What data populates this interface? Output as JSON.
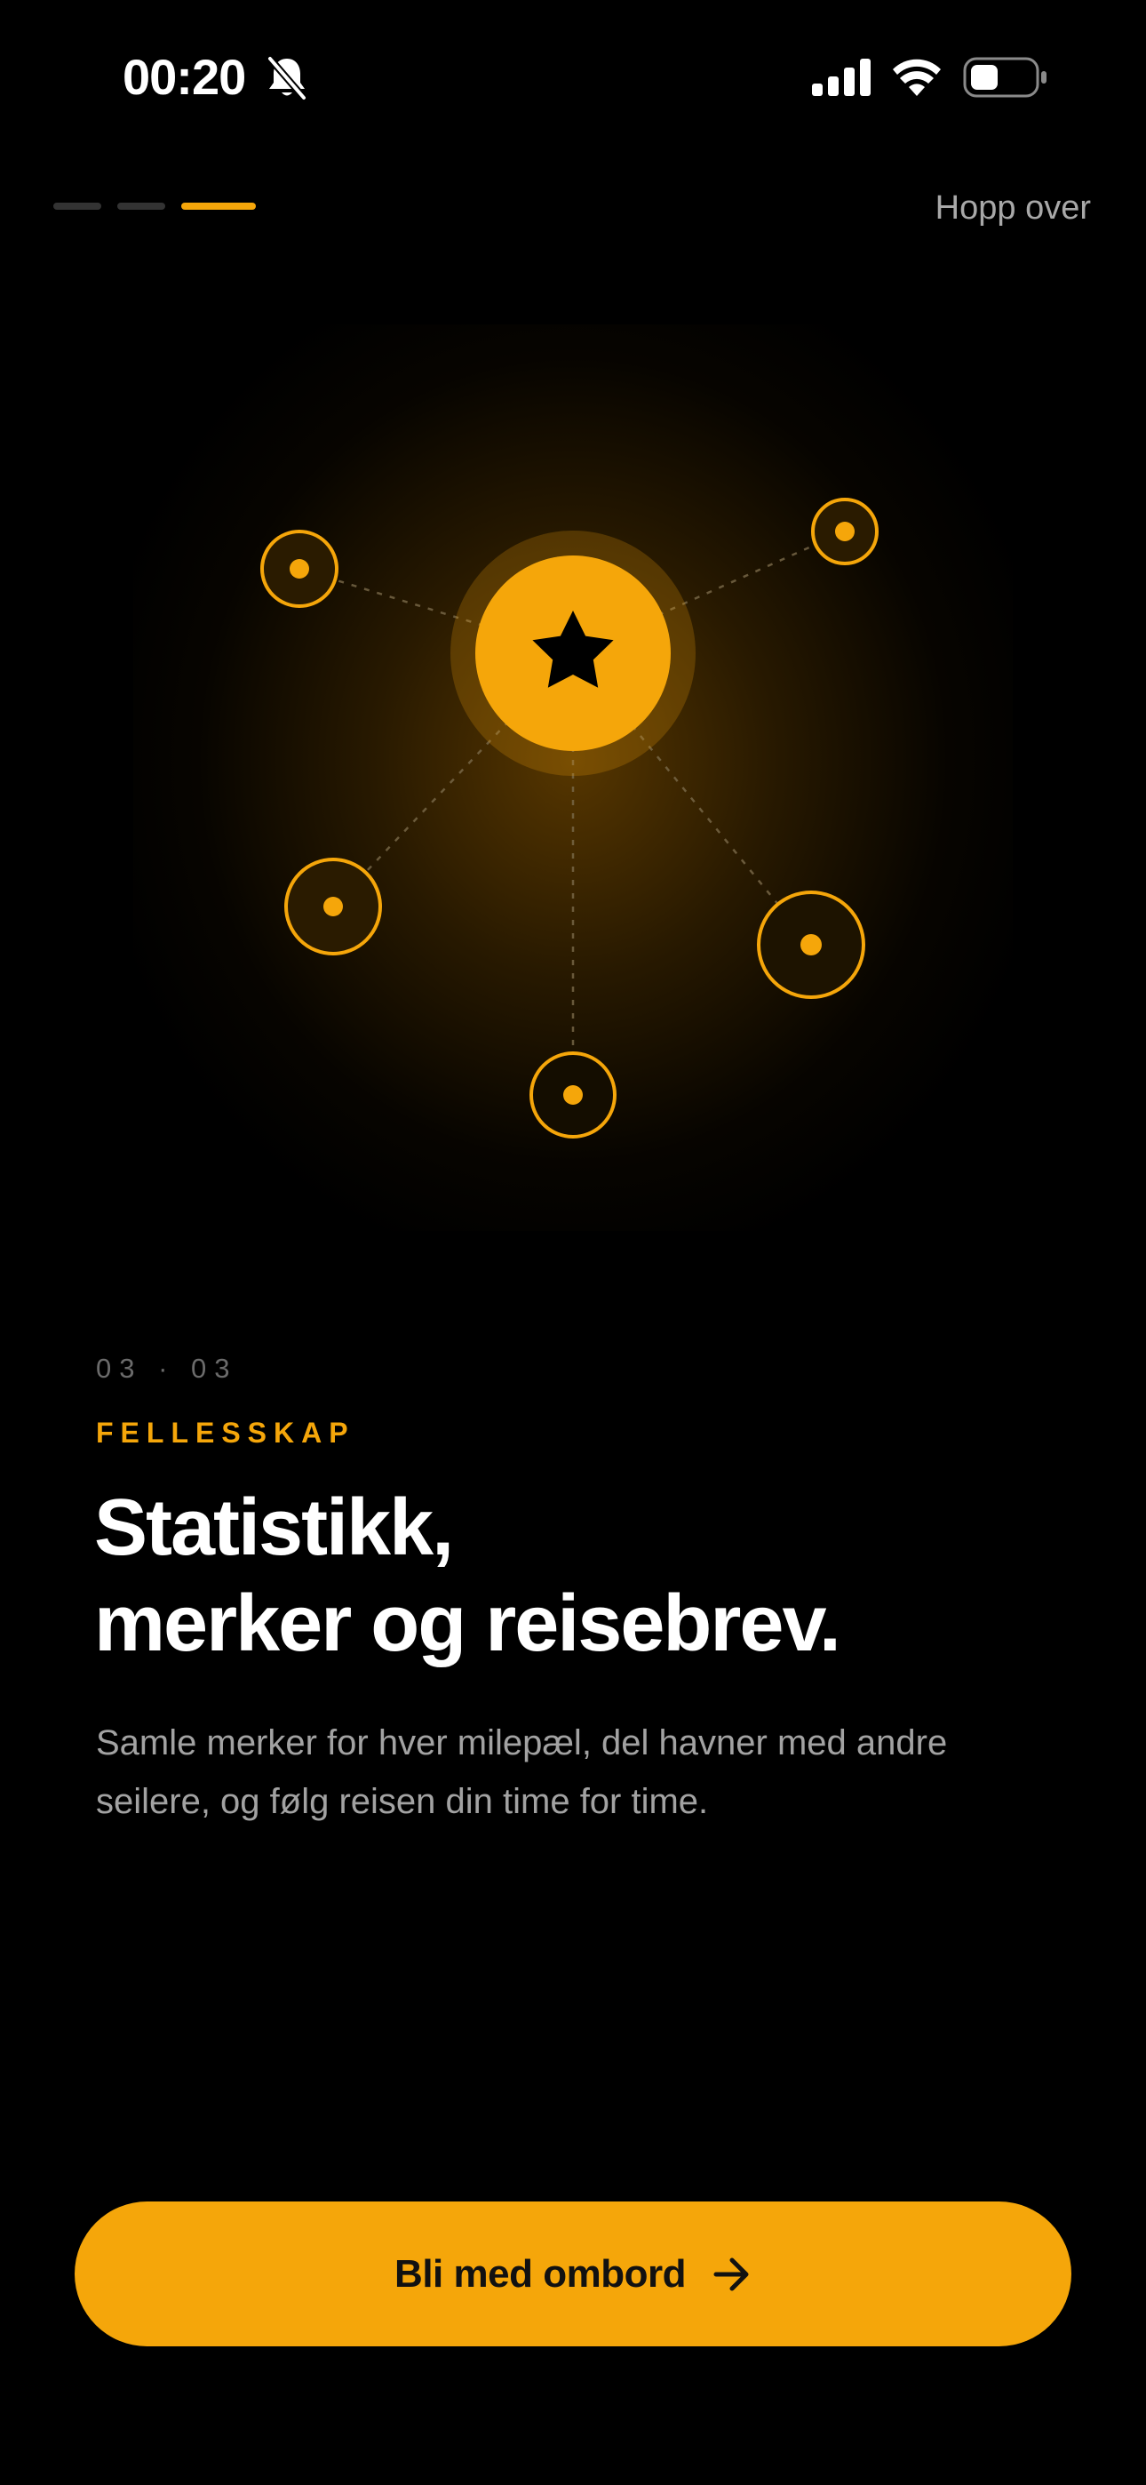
{
  "status_bar": {
    "time": "00:20",
    "icons": [
      "bell-slash-icon",
      "cellular-signal-icon",
      "wifi-icon",
      "battery-icon"
    ]
  },
  "onboarding": {
    "total_steps": 3,
    "current_step": 3,
    "skip_label": "Hopp over"
  },
  "illustration": {
    "center_icon": "star-icon",
    "satellite_icon": "dot-ring-icon",
    "satellite_count": 5
  },
  "content": {
    "step_counter": "03 · 03",
    "eyebrow": "FELLESSKAP",
    "title_line_1": "Statistikk,",
    "title_line_2": "merker og reisebrev.",
    "description": "Samle merker for hver milepæl, del havner med andre seilere, og følg reisen din time for time."
  },
  "cta": {
    "label": "Bli med ombord",
    "icon": "arrow-right-icon"
  },
  "colors": {
    "background": "#000000",
    "accent": "#F5A60A",
    "text_primary": "#FFFFFF",
    "text_secondary": "#A2A2A2",
    "text_muted": "#6B6B6B"
  }
}
